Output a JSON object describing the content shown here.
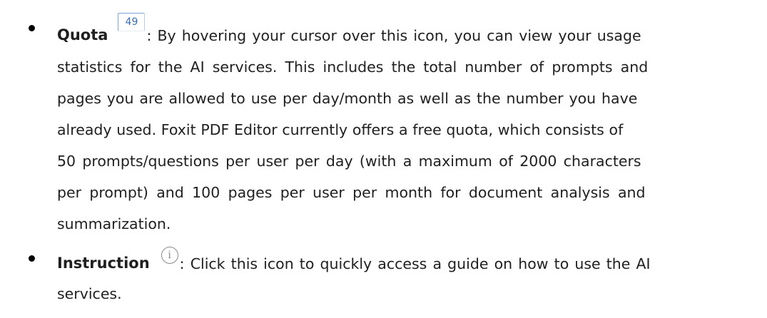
{
  "items": [
    {
      "term": "Quota",
      "icon": "quota-counter-icon",
      "icon_text": "49",
      "lines": [
        ": By hovering your cursor over this icon, you can view your usage",
        "statistics for the AI services. This includes the total number of prompts and",
        "pages you are allowed to use per day/month as well as the number you have",
        "already used. Foxit PDF Editor currently offers a free quota, which consists of",
        "50 prompts/questions per user per day (with a maximum of 2000 characters",
        "per prompt) and 100 pages per user per month for document analysis and",
        "summarization."
      ]
    },
    {
      "term": "Instruction",
      "icon": "info-icon",
      "icon_text": "i",
      "lines": [
        ": Click this icon to quickly access a guide on how to use the AI",
        "services."
      ]
    }
  ]
}
